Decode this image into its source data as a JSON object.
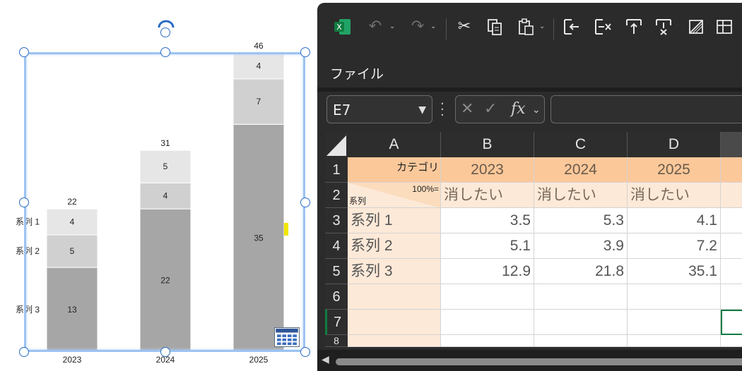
{
  "chart_data": {
    "type": "bar",
    "stacked": true,
    "categories": [
      "2023",
      "2024",
      "2025"
    ],
    "series": [
      {
        "name": "系列 3",
        "values": [
          13,
          22,
          35
        ],
        "color": "#a6a6a6"
      },
      {
        "name": "系列 2",
        "values": [
          5,
          4,
          7
        ],
        "color": "#d0d0d0"
      },
      {
        "name": "系列 1",
        "values": [
          4,
          5,
          4
        ],
        "color": "#e6e6e6"
      }
    ],
    "totals": [
      22,
      31,
      46
    ],
    "legend_placement": "left",
    "grid": false
  },
  "excel": {
    "menu_file": "ファイル",
    "name_box": "E7",
    "formula": "",
    "columns": [
      "A",
      "B",
      "C",
      "D"
    ],
    "rows": [
      "1",
      "2",
      "3",
      "4",
      "5",
      "6",
      "7"
    ],
    "a1": "カテゴリ",
    "a2_top": "100%=",
    "a2_bottom": "系列",
    "header_years": [
      "2023",
      "2024",
      "2025"
    ],
    "row2": [
      "消したい",
      "消したい",
      "消したい"
    ],
    "data_rows": [
      {
        "label": "系列 1",
        "values": [
          "3.5",
          "5.3",
          "4.1"
        ]
      },
      {
        "label": "系列 2",
        "values": [
          "5.1",
          "3.9",
          "7.2"
        ]
      },
      {
        "label": "系列 3",
        "values": [
          "12.9",
          "21.8",
          "35.1"
        ]
      }
    ],
    "icons": {
      "app": "excel-icon",
      "undo": "undo-icon",
      "redo": "redo-icon",
      "cut": "cut-icon",
      "copy": "copy-icon",
      "paste": "paste-icon",
      "insert_col": "insert-column-icon",
      "delete_col": "delete-column-icon",
      "insert_row": "insert-row-icon",
      "delete_row": "delete-row-icon",
      "clear": "clear-icon",
      "freeze": "freeze-panes-icon"
    },
    "accent": "#fbc89a",
    "accent_light": "#fde9d8",
    "cell_peach": "#fbdcbc"
  }
}
